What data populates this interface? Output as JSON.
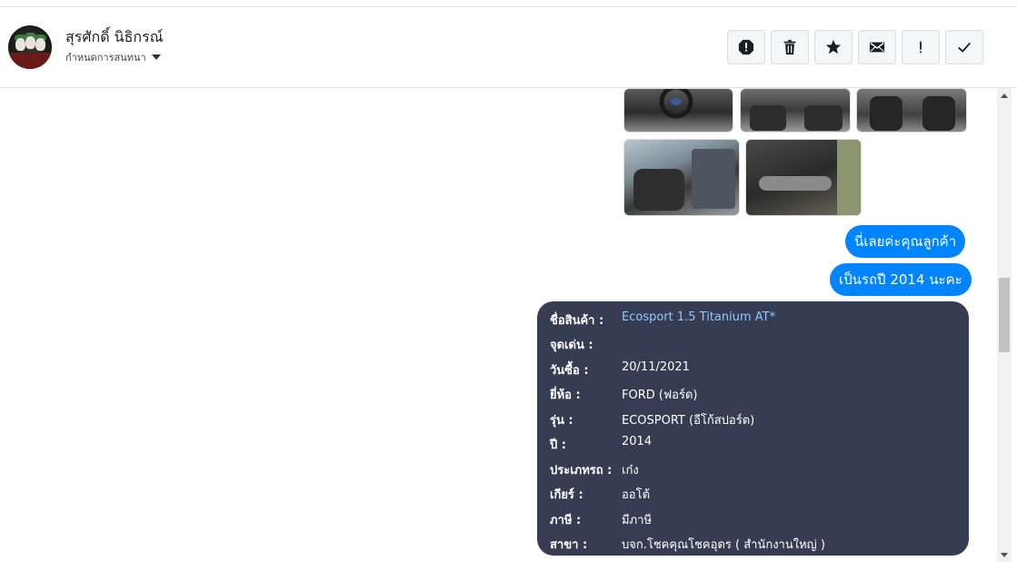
{
  "contact": {
    "name": "สุรศักดิ์ นิธิกรณ์",
    "subtitle": "กำหนดการสนทนา"
  },
  "actions": [
    {
      "name": "report-icon",
      "label": "report"
    },
    {
      "name": "trash-icon",
      "label": "delete"
    },
    {
      "name": "star-icon",
      "label": "star"
    },
    {
      "name": "mail-icon",
      "label": "mail"
    },
    {
      "name": "exclamation-icon",
      "label": "!"
    },
    {
      "name": "check-icon",
      "label": "done"
    }
  ],
  "messages": [
    {
      "text": "นี่เลยค่ะคุณลูกค้า"
    },
    {
      "text": "เป็นรถปี 2014 นะคะ"
    }
  ],
  "product_card": {
    "rows": [
      {
        "key": "ชื่อสินค้า :",
        "value": "Ecosport 1.5 Titanium AT*"
      },
      {
        "key": "จุดเด่น :",
        "value": ""
      },
      {
        "key": "วันซื้อ :",
        "value": "20/11/2021"
      },
      {
        "key": "ยี่ห้อ :",
        "value": "FORD (ฟอร์ด)"
      },
      {
        "key": "รุ่น :",
        "value": "ECOSPORT (อีโก้สปอร์ต)"
      },
      {
        "key": "ปี :",
        "value": "2014"
      },
      {
        "key": "ประเภทรถ :",
        "value": "เก๋ง"
      },
      {
        "key": "เกียร์ :",
        "value": "ออโต้"
      },
      {
        "key": "ภาษี :",
        "value": "มีภาษี"
      },
      {
        "key": "สาขา :",
        "value": "บจก.โชคคุณโชคอุดร ( สำนักงานใหญ่ )"
      }
    ]
  },
  "colors": {
    "bubble": "#0084ff",
    "card": "#363d52",
    "link": "#8fc7ff"
  }
}
